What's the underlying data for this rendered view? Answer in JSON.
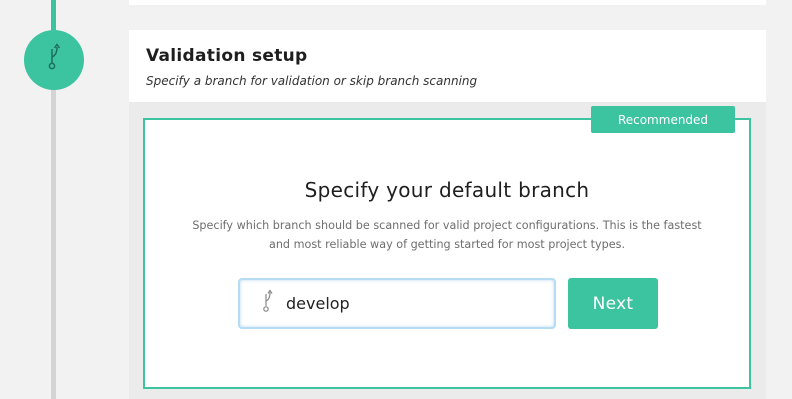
{
  "colors": {
    "accent": "#3cc3a0",
    "timeline_inactive": "#d4d4d4",
    "input_focus_border": "#b6dcf3"
  },
  "timeline": {
    "step_icon": "branch-icon"
  },
  "step": {
    "title": "Validation setup",
    "subtitle": "Specify a branch for validation or skip branch scanning"
  },
  "option": {
    "badge": "Recommended",
    "title": "Specify your default branch",
    "description": "Specify which branch should be scanned for valid project configurations. This is the fastest and most reliable way of getting started for most project types.",
    "branch_input_value": "develop",
    "branch_input_icon": "branch-icon",
    "next_label": "Next"
  }
}
